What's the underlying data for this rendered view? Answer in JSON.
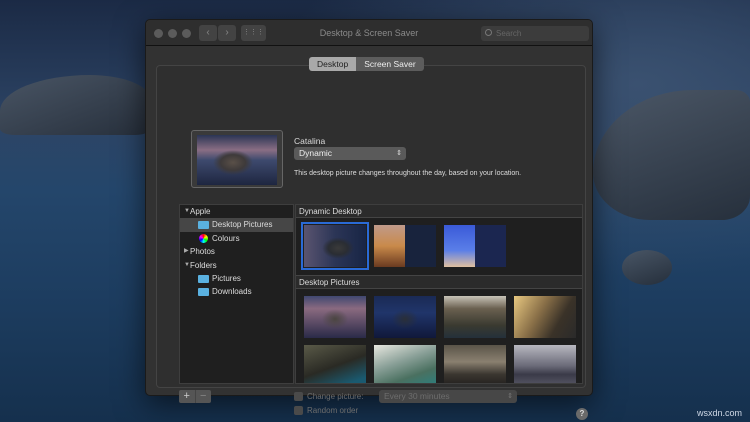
{
  "window": {
    "title": "Desktop & Screen Saver",
    "search_placeholder": "Search",
    "back": "‹",
    "forward": "›",
    "grid": "⋮⋮⋮"
  },
  "tabs": [
    {
      "label": "Desktop",
      "selected": true
    },
    {
      "label": "Screen Saver",
      "selected": false
    }
  ],
  "current": {
    "name": "Catalina",
    "mode": "Dynamic",
    "description": "This desktop picture changes throughout the day, based on your location."
  },
  "sources": [
    {
      "label": "Apple",
      "type": "group",
      "expanded": true
    },
    {
      "label": "Desktop Pictures",
      "type": "folder",
      "selected": true
    },
    {
      "label": "Colours",
      "type": "colours"
    },
    {
      "label": "Photos",
      "type": "group",
      "expanded": false
    },
    {
      "label": "Folders",
      "type": "group",
      "expanded": true
    },
    {
      "label": "Pictures",
      "type": "folder"
    },
    {
      "label": "Downloads",
      "type": "folder"
    }
  ],
  "sections": {
    "dynamic": "Dynamic Desktop",
    "pictures": "Desktop Pictures"
  },
  "controls": {
    "add": "+",
    "remove": "−",
    "change_picture": "Change picture:",
    "interval": "Every 30 minutes",
    "random_order": "Random order",
    "help": "?"
  },
  "watermark": "wsxdn.com"
}
